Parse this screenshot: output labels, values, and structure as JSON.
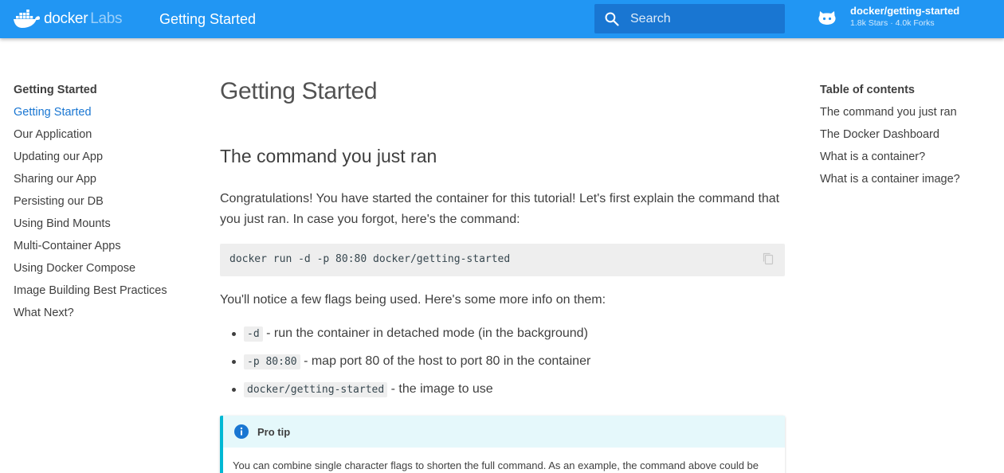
{
  "header": {
    "logo_text": "docker",
    "logo_suffix": "Labs",
    "title": "Getting Started",
    "search_placeholder": "Search",
    "repo_name": "docker/getting-started",
    "repo_facts": "1.8k Stars · 4.0k Forks",
    "icons": {
      "logo": "docker-whale-icon",
      "search": "search-icon",
      "repo": "github-icon"
    }
  },
  "nav": {
    "title": "Getting Started",
    "items": [
      "Getting Started",
      "Our Application",
      "Updating our App",
      "Sharing our App",
      "Persisting our DB",
      "Using Bind Mounts",
      "Multi-Container Apps",
      "Using Docker Compose",
      "Image Building Best Practices",
      "What Next?"
    ],
    "active_index": 0
  },
  "toc": {
    "title": "Table of contents",
    "items": [
      "The command you just ran",
      "The Docker Dashboard",
      "What is a container?",
      "What is a container image?"
    ]
  },
  "content": {
    "title": "Getting Started",
    "section_title": "The command you just ran",
    "intro": "Congratulations! You have started the container for this tutorial! Let's first explain the command that you just ran. In case you forgot, here's the command:",
    "command": "docker run -d -p 80:80 docker/getting-started",
    "flags_intro": "You'll notice a few flags being used. Here's some more info on them:",
    "flags": [
      {
        "code": "-d",
        "text": " - run the container in detached mode (in the background)"
      },
      {
        "code": "-p 80:80",
        "text": " - map port 80 of the host to port 80 in the container"
      },
      {
        "code": "docker/getting-started",
        "text": " - the image to use"
      }
    ],
    "pro_tip": {
      "title": "Pro tip",
      "body": "You can combine single character flags to shorten the full command. As an example, the command above could be"
    }
  },
  "colors": {
    "header_bg": "#2196f3",
    "search_bg": "#1976d2",
    "active_link": "#1976d2",
    "admonition_accent": "#00b8d4"
  }
}
